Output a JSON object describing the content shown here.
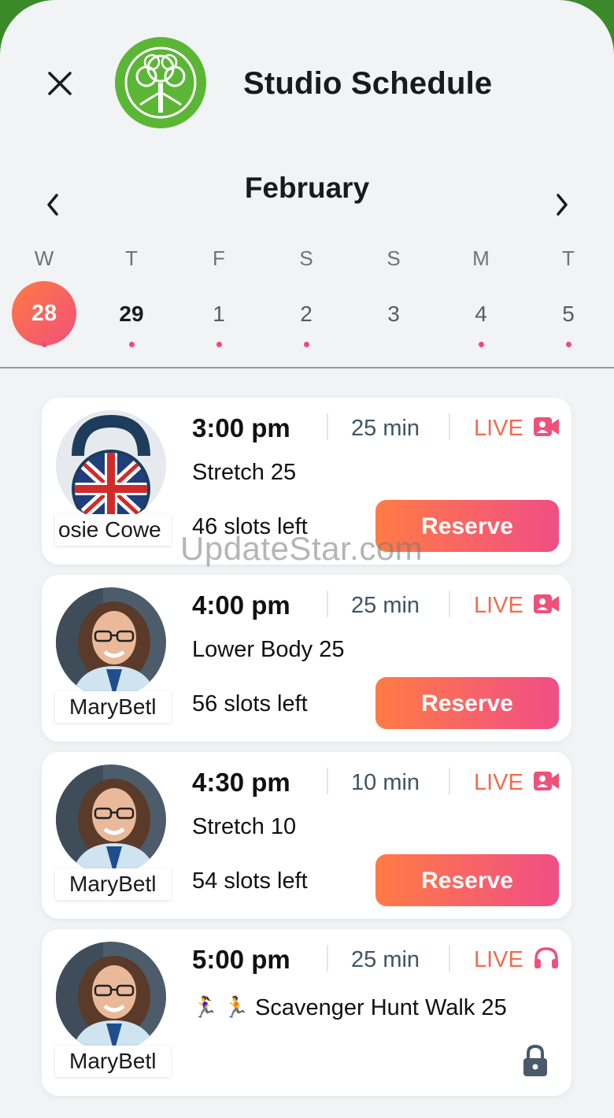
{
  "header": {
    "title": "Studio Schedule",
    "close_icon": "close-icon",
    "logo_icon": "tree-of-life-logo"
  },
  "calendar": {
    "month": "February",
    "prev_icon": "chevron-left-icon",
    "next_icon": "chevron-right-icon",
    "days": [
      {
        "weekday": "W",
        "date": "28",
        "selected": true,
        "has_classes": true
      },
      {
        "weekday": "T",
        "date": "29",
        "selected": false,
        "has_classes": true
      },
      {
        "weekday": "F",
        "date": "1",
        "selected": false,
        "has_classes": true
      },
      {
        "weekday": "S",
        "date": "2",
        "selected": false,
        "has_classes": true
      },
      {
        "weekday": "S",
        "date": "3",
        "selected": false,
        "has_classes": false
      },
      {
        "weekday": "M",
        "date": "4",
        "selected": false,
        "has_classes": true
      },
      {
        "weekday": "T",
        "date": "5",
        "selected": false,
        "has_classes": true
      }
    ]
  },
  "classes": [
    {
      "time": "3:00 pm",
      "duration": "25 min",
      "live": "LIVE",
      "live_icon": "video-camera-icon",
      "name": "Stretch 25",
      "slots": "46 slots left",
      "instructor": "osie Cowe",
      "action": "Reserve",
      "avatar": "kettlebell-uk-flag-avatar"
    },
    {
      "time": "4:00 pm",
      "duration": "25 min",
      "live": "LIVE",
      "live_icon": "video-camera-icon",
      "name": "Lower Body 25",
      "slots": "56 slots left",
      "instructor": "MaryBetl",
      "action": "Reserve",
      "avatar": "instructor-photo-avatar"
    },
    {
      "time": "4:30 pm",
      "duration": "10 min",
      "live": "LIVE",
      "live_icon": "video-camera-icon",
      "name": "Stretch 10",
      "slots": "54 slots left",
      "instructor": "MaryBetl",
      "action": "Reserve",
      "avatar": "instructor-photo-avatar"
    },
    {
      "time": "5:00 pm",
      "duration": "25 min",
      "live": "LIVE",
      "live_icon": "headphones-icon",
      "name": "Scavenger Hunt Walk 25",
      "name_prefix": "🏃‍♀️ 🏃",
      "instructor": "MaryBetl",
      "locked": true,
      "lock_icon": "lock-icon",
      "avatar": "instructor-photo-avatar"
    }
  ],
  "watermark": "UpdateStar.com",
  "colors": {
    "accent_gradient_start": "#ff7b45",
    "accent_gradient_end": "#f04e85",
    "live": "#f26b4f",
    "dot": "#ef4a78",
    "logo_green": "#5bb636"
  }
}
